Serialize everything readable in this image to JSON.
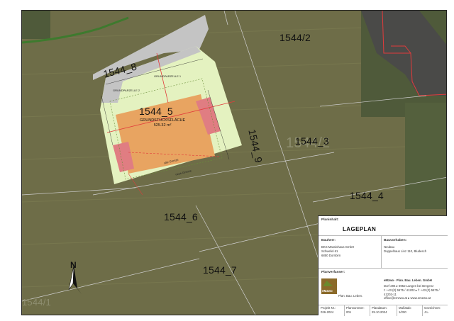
{
  "map": {
    "parcels": {
      "p1544_8": "1544_8",
      "p1544_2": "1544/2",
      "p1544_5": "1544_5",
      "p1544_9": "1544_9",
      "p1544_3": "1544_3",
      "p1544_3_bg": "1544/2",
      "p1544_4": "1544_4",
      "p1544_6": "1544_6",
      "p1544_7": "1544_7",
      "p1544_1": "1544/1"
    },
    "grund_label": "GRUNDSTÜCKSFLÄCHE",
    "grund_area": "525.32 m²",
    "alte_grenze": "alte Grenze",
    "neue_grenze": "neue Grenze",
    "plot_left_label": "GRUNDPARZELLE 2",
    "plot_top_label": "GRUNDPARZELLE 1",
    "north_label": "N",
    "colors": {
      "orchard": "#6b6a45",
      "road": "#c4c4c4",
      "plot_green": "#e4f2c0",
      "building": "#e8a461",
      "garage": "#e07d82",
      "boundary_red": "#e23b3b"
    }
  },
  "title_block": {
    "planinhalt_label": "Planinhalt:",
    "planinhalt_value": "LAGEPLAN",
    "bauherr_label": "Bauherr:",
    "bauherr_lines": [
      "BKS Massivhaus GmbH",
      "Schwefel 61",
      "6850 Dornbirn"
    ],
    "bauvorhaben_label": "Bauvorhaben:",
    "bauvorhaben_lines": [
      "Neubau",
      "Doppelhaus Linz 110, Bludesch"
    ],
    "planverfasser_label": "Planverfasser:",
    "firm_name": "eMzwo · Plan. Bau. Leben. GmbH",
    "firm_lines": [
      "Dorf 294 ▸ 6952 Langen bei Bregenz",
      "t: +43 (0) 5575 / 41202 ▸ f: +43 (0) 5575 / 41202-11",
      "office@emzwo.at ▸ www.emzwo.at"
    ],
    "logo_text": "eMzwo",
    "logo_tagline": "Plan. Bau. Leben.",
    "footer": [
      {
        "label": "Projekt Nr.:",
        "value": "026-2024"
      },
      {
        "label": "Plannummer:",
        "value": "001"
      },
      {
        "label": "Plandatum:",
        "value": "29.10.2024"
      },
      {
        "label": "Maßstab:",
        "value": "1/200"
      },
      {
        "label": "Gezeichnet:",
        "value": "J.L."
      }
    ]
  }
}
